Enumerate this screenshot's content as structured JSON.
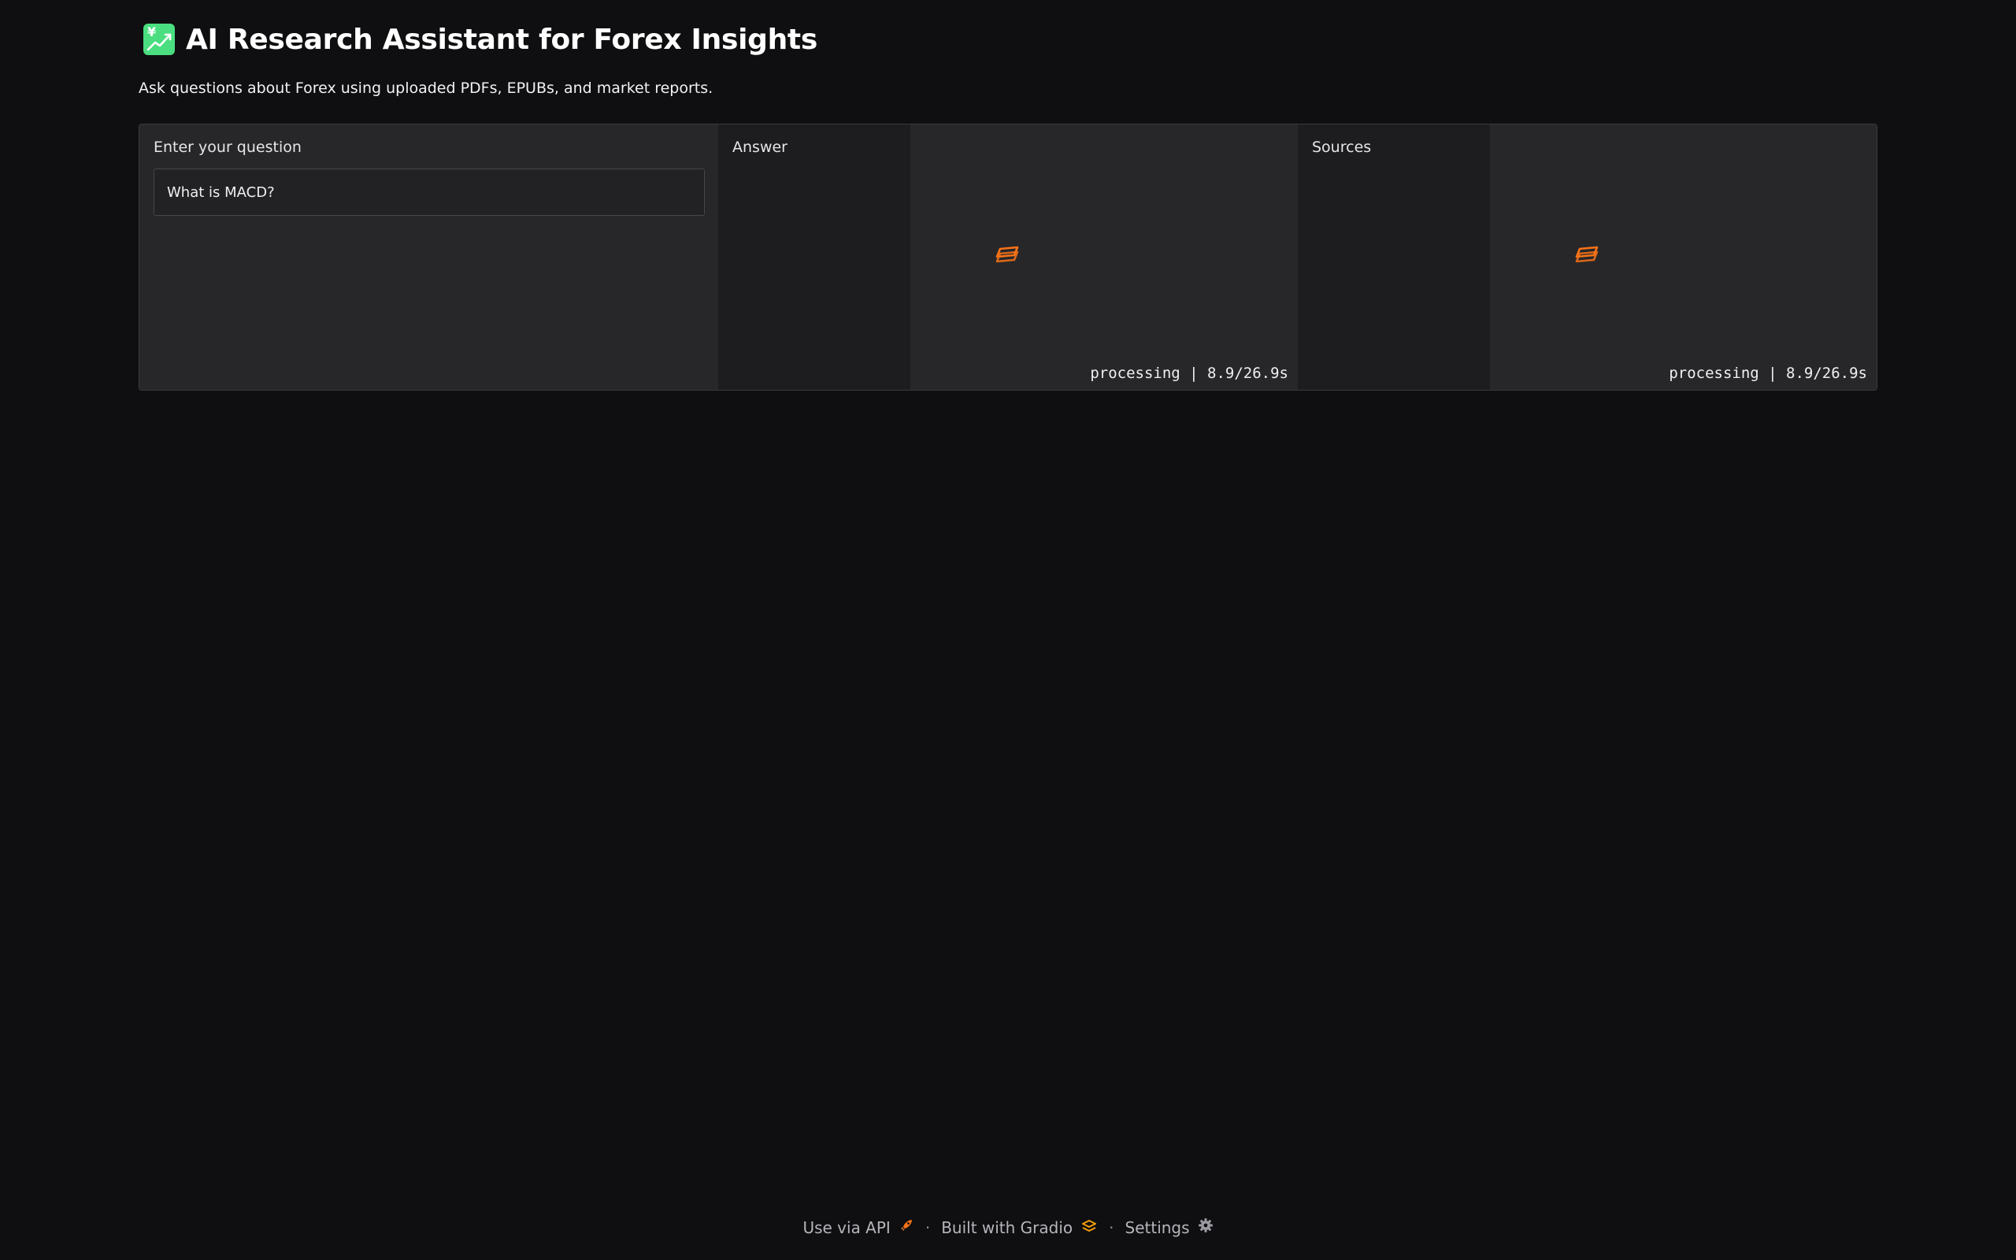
{
  "header": {
    "title": "AI Research Assistant for Forex Insights",
    "title_icon": "chart-increasing-with-yen-icon",
    "subtitle": "Ask questions about Forex using uploaded PDFs, EPUBs, and market reports."
  },
  "question": {
    "label": "Enter your question",
    "value": "What is MACD?"
  },
  "answer": {
    "label": "Answer",
    "status": "processing | 8.9/26.9s"
  },
  "sources": {
    "label": "Sources",
    "status": "processing | 8.9/26.9s"
  },
  "footer": {
    "api_label": "Use via API",
    "separator": "·",
    "gradio_label": "Built with Gradio",
    "settings_label": "Settings"
  },
  "colors": {
    "accent": "#f97316",
    "emoji_bg": "#4ade80",
    "background": "#0f0f11",
    "panel": "#27272a"
  }
}
